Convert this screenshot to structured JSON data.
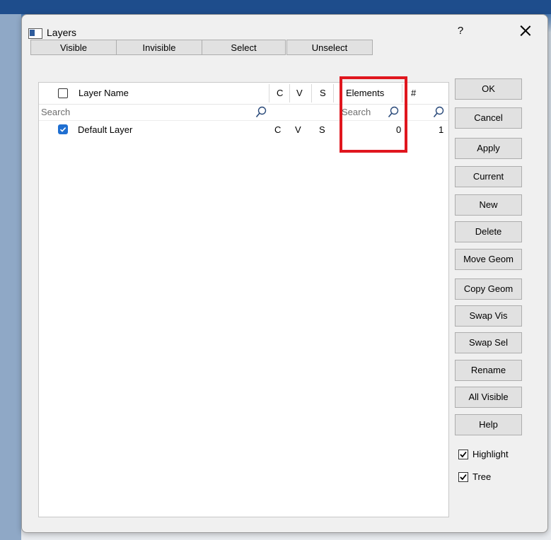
{
  "window": {
    "title": "Layers",
    "help": "?"
  },
  "toolbar": {
    "visible": "Visible",
    "invisible": "Invisible",
    "select": "Select",
    "unselect": "Unselect"
  },
  "table": {
    "headers": {
      "layer_name": "Layer Name",
      "c": "C",
      "v": "V",
      "s": "S",
      "elements": "Elements",
      "num": "#"
    },
    "search": {
      "layer_name": "Search",
      "elements": "Search"
    },
    "rows": [
      {
        "checked": true,
        "name": "Default Layer",
        "c": "C",
        "v": "V",
        "s": "S",
        "elements": "0",
        "num": "1"
      }
    ]
  },
  "buttons": {
    "ok": "OK",
    "cancel": "Cancel",
    "apply": "Apply",
    "current": "Current",
    "new": "New",
    "delete": "Delete",
    "move_geom": "Move Geom",
    "copy_geom": "Copy Geom",
    "swap_vis": "Swap Vis",
    "swap_sel": "Swap Sel",
    "rename": "Rename",
    "all_visible": "All Visible",
    "help": "Help"
  },
  "options": {
    "highlight": {
      "label": "Highlight",
      "checked": true
    },
    "tree": {
      "label": "Tree",
      "checked": true
    }
  },
  "colors": {
    "highlight_box": "#e0161e",
    "checkbox_accent": "#1f6fd1"
  }
}
